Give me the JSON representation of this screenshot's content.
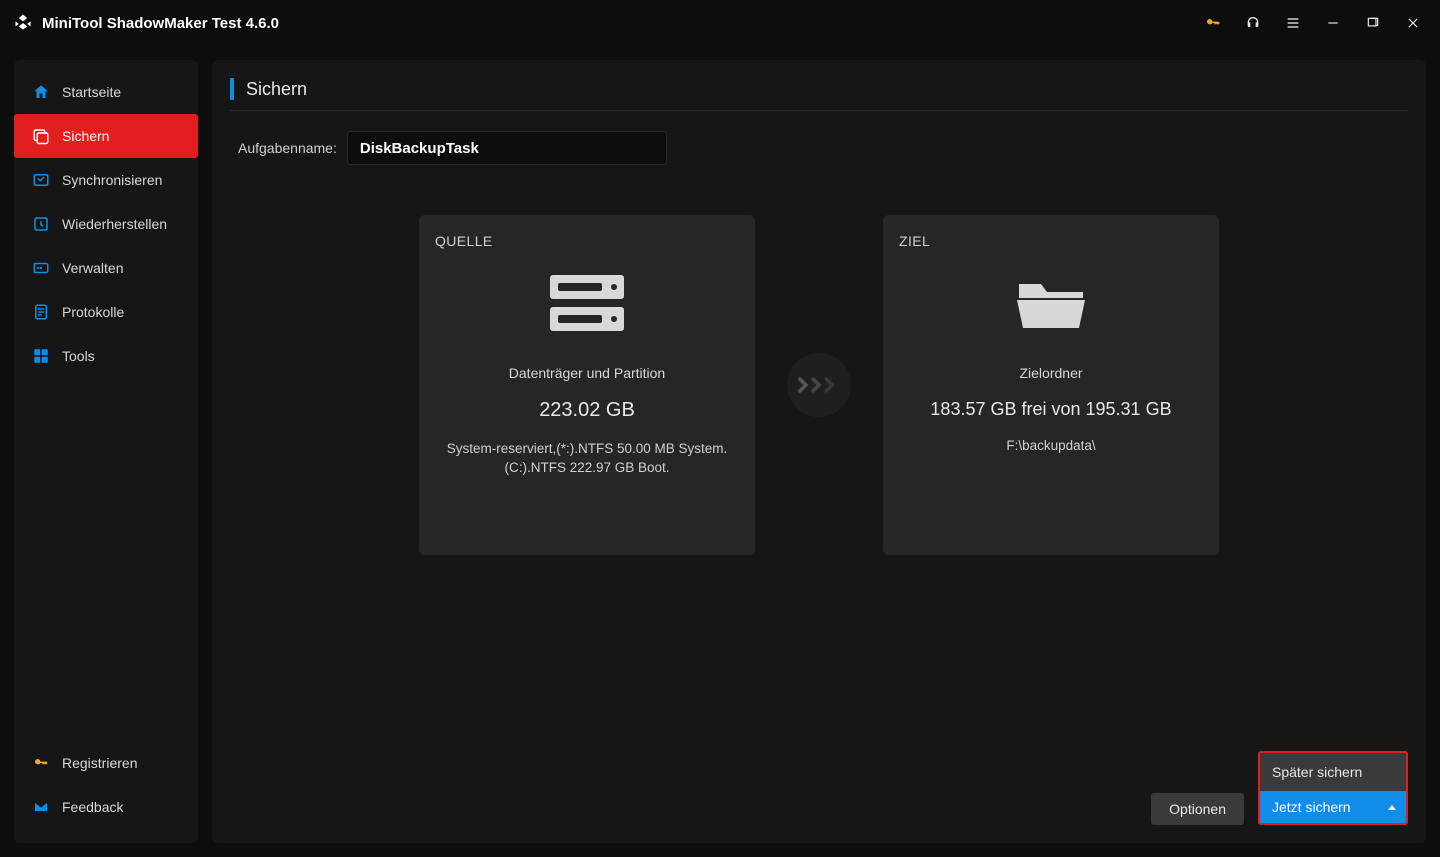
{
  "titlebar": {
    "app_title": "MiniTool ShadowMaker Test 4.6.0"
  },
  "sidebar": {
    "items": [
      {
        "label": "Startseite",
        "icon": "home"
      },
      {
        "label": "Sichern",
        "icon": "backup",
        "active": true
      },
      {
        "label": "Synchronisieren",
        "icon": "sync"
      },
      {
        "label": "Wiederherstellen",
        "icon": "restore"
      },
      {
        "label": "Verwalten",
        "icon": "manage"
      },
      {
        "label": "Protokolle",
        "icon": "log"
      },
      {
        "label": "Tools",
        "icon": "tools"
      }
    ],
    "footer": [
      {
        "label": "Registrieren",
        "icon": "key"
      },
      {
        "label": "Feedback",
        "icon": "mail"
      }
    ]
  },
  "page": {
    "title": "Sichern",
    "taskname_label": "Aufgabenname:",
    "taskname_value": "DiskBackupTask"
  },
  "source": {
    "heading": "QUELLE",
    "line1": "Datenträger und Partition",
    "size": "223.02 GB",
    "details": "System-reserviert,(*:).NTFS 50.00 MB System.(C:).NTFS 222.97 GB Boot."
  },
  "target": {
    "heading": "ZIEL",
    "line1": "Zielordner",
    "space": "183.57 GB frei von 195.31 GB",
    "path": "F:\\backupdata\\"
  },
  "actions": {
    "options": "Optionen",
    "later": "Später sichern",
    "now": "Jetzt sichern"
  }
}
